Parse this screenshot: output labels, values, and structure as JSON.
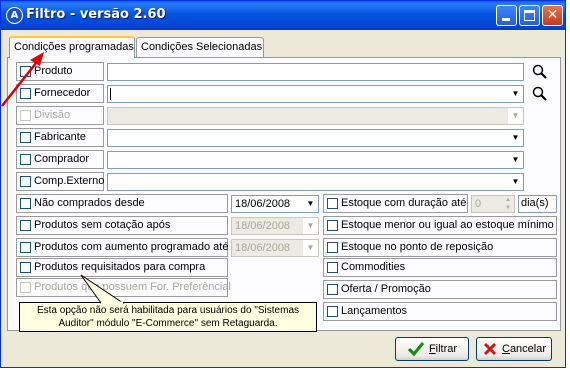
{
  "window": {
    "title": "Filtro - versão 2.60",
    "icon_letter": "A"
  },
  "tabs": [
    {
      "label": "Condições programadas",
      "active": true
    },
    {
      "label": "Condições Selecionadas",
      "active": false
    }
  ],
  "filters": [
    {
      "label": "Produto",
      "value": "",
      "has_dropdown": false,
      "has_search": true,
      "enabled": true
    },
    {
      "label": "Fornecedor",
      "value": "",
      "has_dropdown": true,
      "has_search": true,
      "enabled": true
    },
    {
      "label": "Divisão",
      "value": "",
      "has_dropdown": true,
      "has_search": false,
      "enabled": false
    },
    {
      "label": "Fabricante",
      "value": "",
      "has_dropdown": true,
      "has_search": false,
      "enabled": true
    },
    {
      "label": "Comprador",
      "value": "",
      "has_dropdown": true,
      "has_search": false,
      "enabled": true
    },
    {
      "label": "Comp.Externo",
      "value": "",
      "has_dropdown": true,
      "has_search": false,
      "enabled": true
    }
  ],
  "left_options": [
    {
      "label": "Não comprados desde",
      "date": "18/06/2008",
      "date_enabled": true,
      "enabled": true
    },
    {
      "label": "Produtos sem cotação após",
      "date": "18/06/2008",
      "date_enabled": false,
      "enabled": true
    },
    {
      "label": "Produtos com aumento programado até",
      "date": "18/06/2008",
      "date_enabled": false,
      "enabled": true
    },
    {
      "label": "Produtos requisitados para compra",
      "enabled": true
    },
    {
      "label": "Produtos que possuem For. Preferêncial",
      "enabled": false
    }
  ],
  "right_options": [
    {
      "label": "Estoque com duração até"
    },
    {
      "label": "Estoque menor ou igual ao estoque mínimo"
    },
    {
      "label": "Estoque no ponto de reposição"
    },
    {
      "label": "Commodities"
    },
    {
      "label": "Oferta / Promoção"
    },
    {
      "label": "Lançamentos"
    }
  ],
  "duration": {
    "value": "0",
    "unit": "dia(s)"
  },
  "tooltip": {
    "line1": "Esta opção não será habilitada para usuários do \"Sistemas",
    "line2": "Auditor\" módulo \"E-Commerce\" sem Retaguarda."
  },
  "buttons": {
    "filter": {
      "label": "Filtrar",
      "mnemonic": "F",
      "rest": "iltrar"
    },
    "cancel": {
      "label": "Cancelar",
      "mnemonic": "C",
      "rest": "ancelar"
    }
  },
  "colors": {
    "title_bar": "#0054e3",
    "tab_highlight": "#ffc83c",
    "tooltip_bg": "#ffffe1",
    "arrow": "#e00000"
  }
}
